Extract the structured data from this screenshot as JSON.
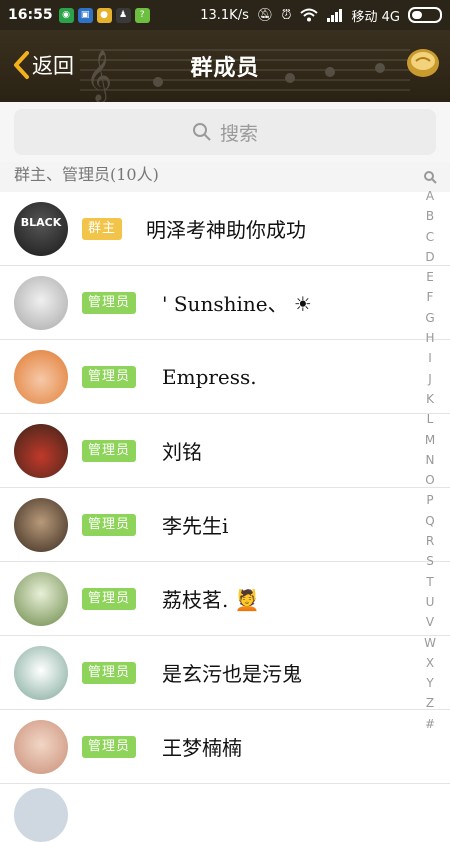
{
  "status_bar": {
    "time": "16:55",
    "network_speed": "13.1K/s",
    "carrier": "移动 4G",
    "app_icons": [
      {
        "name": "wechat-app-icon",
        "color": "#2aa34a"
      },
      {
        "name": "weibo-app-icon",
        "color": "#2f73c9"
      },
      {
        "name": "game-app-icon",
        "color": "#e6b12c"
      },
      {
        "name": "qq-app-icon",
        "color": "#3a3a3a"
      },
      {
        "name": "coupon-app-icon",
        "color": "#6cbf3f"
      }
    ]
  },
  "header": {
    "back_label": "返回",
    "title": "群成员"
  },
  "search": {
    "placeholder": "搜索"
  },
  "section": {
    "title": "群主、管理员(10人)"
  },
  "members": [
    {
      "badge": "群主",
      "badge_type": "owner",
      "name": "明泽考神助你成功",
      "avatar_color": "#3a3a3a"
    },
    {
      "badge": "管理员",
      "badge_type": "admin",
      "name": "  ' Sunshine、  ☀",
      "avatar_color": "#cfcfcf"
    },
    {
      "badge": "管理员",
      "badge_type": "admin",
      "name": "Empress.",
      "avatar_color": "#e58a3c"
    },
    {
      "badge": "管理员",
      "badge_type": "admin",
      "name": "刘铭",
      "avatar_color": "#6c2b22"
    },
    {
      "badge": "管理员",
      "badge_type": "admin",
      "name": "李先生i",
      "avatar_color": "#5a4a3a"
    },
    {
      "badge": "管理员",
      "badge_type": "admin",
      "name": "荔枝茗. 💆",
      "avatar_color": "#8fa07a"
    },
    {
      "badge": "管理员",
      "badge_type": "admin",
      "name": "是玄污也是污鬼",
      "avatar_color": "#b7c7c0"
    },
    {
      "badge": "管理员",
      "badge_type": "admin",
      "name": "王梦楠楠",
      "avatar_color": "#d9b4a0"
    }
  ],
  "index_letters": [
    "A",
    "B",
    "C",
    "D",
    "E",
    "F",
    "G",
    "H",
    "I",
    "J",
    "K",
    "L",
    "M",
    "N",
    "O",
    "P",
    "Q",
    "R",
    "S",
    "T",
    "U",
    "V",
    "W",
    "X",
    "Y",
    "Z",
    "#"
  ],
  "colors": {
    "owner_badge": "#f3c44a",
    "admin_badge": "#8ed35a",
    "header_bg": "#2b2418",
    "back_accent": "#f2b21b"
  }
}
